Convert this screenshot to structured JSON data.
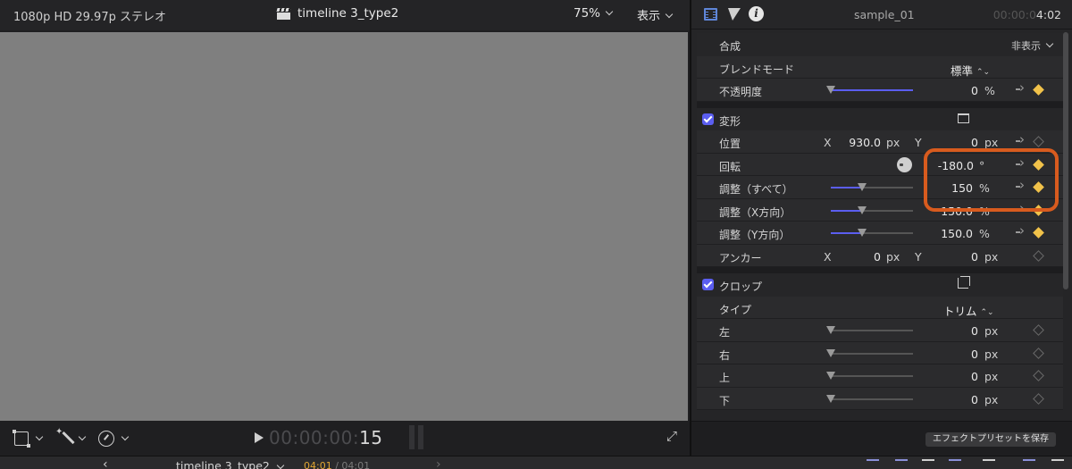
{
  "viewer": {
    "format": "1080p HD 29.97p ステレオ",
    "title": "timeline 3_type2",
    "zoom": "75%",
    "view_menu": "表示",
    "timecode_dim": "00:00:00:",
    "timecode_frames": "15",
    "icons": [
      "transform-icon",
      "enhance-icon",
      "retime-icon",
      "play-icon",
      "fullscreen-icon"
    ]
  },
  "inspector": {
    "clip_name": "sample_01",
    "clip_time_dim": "00:00:0",
    "clip_time_bright": "4:02",
    "compositing": {
      "title": "合成",
      "hide": "非表示",
      "blend_label": "ブレンドモード",
      "blend_value": "標準",
      "opacity_label": "不透明度",
      "opacity_value": "0",
      "opacity_unit": "%"
    },
    "transform": {
      "title": "変形",
      "position_label": "位置",
      "x_label": "X",
      "x_value": "930.0",
      "x_unit": "px",
      "y_label": "Y",
      "y_value": "0",
      "y_unit": "px",
      "rotation_label": "回転",
      "rotation_value": "-180.0",
      "rotation_unit": "°",
      "scale_all_label": "調整（すべて）",
      "scale_all_value": "150",
      "scale_all_unit": "%",
      "scale_x_label": "調整（X方向）",
      "scale_x_value": "150.0",
      "scale_x_unit": "%",
      "scale_y_label": "調整（Y方向）",
      "scale_y_value": "150.0",
      "scale_y_unit": "%",
      "anchor_label": "アンカー",
      "anchor_x_label": "X",
      "anchor_x_value": "0",
      "anchor_x_unit": "px",
      "anchor_y_label": "Y",
      "anchor_y_value": "0",
      "anchor_y_unit": "px"
    },
    "crop": {
      "title": "クロップ",
      "type_label": "タイプ",
      "type_value": "トリム",
      "left_label": "左",
      "left_value": "0",
      "right_label": "右",
      "right_value": "0",
      "top_label": "上",
      "top_value": "0",
      "bottom_label": "下",
      "bottom_value": "0",
      "unit": "px"
    },
    "save_preset": "エフェクトプリセットを保存",
    "accent_color": "#5b5ef0",
    "keyframe_color": "#f1c24a",
    "highlight_color": "#d85b1e"
  },
  "timeline": {
    "name": "timeline 3_type2",
    "current": "04:01",
    "total": "/ 04:01"
  }
}
